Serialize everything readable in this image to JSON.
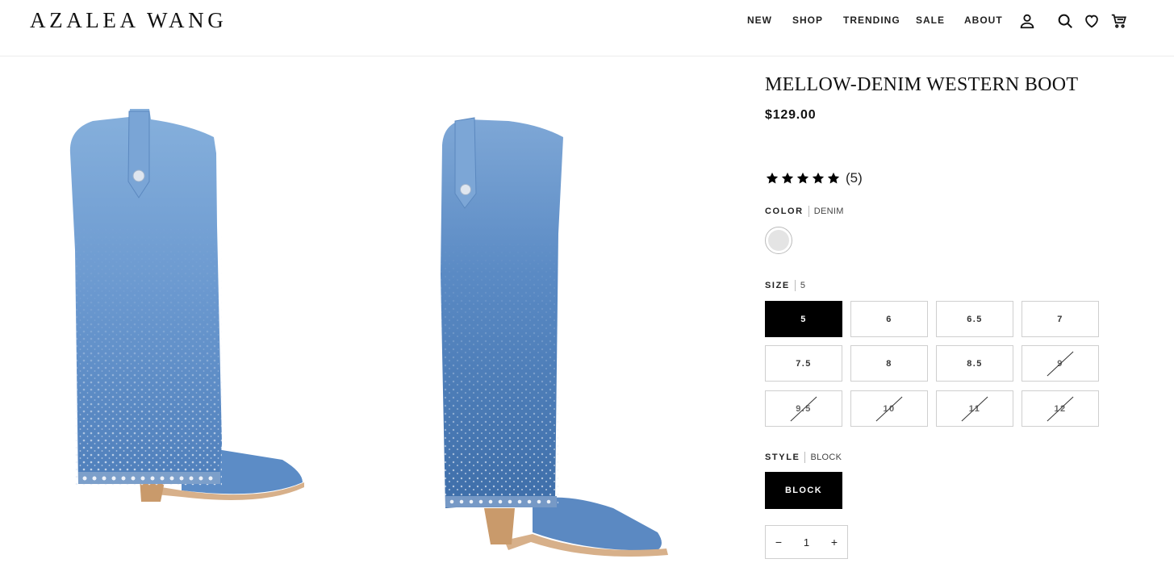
{
  "header": {
    "logo": "AZALEA WANG",
    "nav": [
      "NEW",
      "SHOP",
      "TRENDING",
      "SALE",
      "ABOUT"
    ],
    "icons": [
      "account-icon",
      "search-icon",
      "wishlist-heart-icon",
      "cart-icon"
    ]
  },
  "gallery": {
    "images": [
      "boot-side-view",
      "boot-angle-view"
    ]
  },
  "product": {
    "title": "MELLOW-DENIM WESTERN BOOT",
    "price": "$129.00",
    "rating": {
      "stars": 5,
      "count": "(5)"
    },
    "color": {
      "label": "COLOR",
      "value": "DENIM",
      "swatch_color": "#e4e4e4"
    },
    "size": {
      "label": "SIZE",
      "value": "5",
      "options": [
        {
          "label": "5",
          "selected": true,
          "available": true
        },
        {
          "label": "6",
          "selected": false,
          "available": true
        },
        {
          "label": "6.5",
          "selected": false,
          "available": true
        },
        {
          "label": "7",
          "selected": false,
          "available": true
        },
        {
          "label": "7.5",
          "selected": false,
          "available": true
        },
        {
          "label": "8",
          "selected": false,
          "available": true
        },
        {
          "label": "8.5",
          "selected": false,
          "available": true
        },
        {
          "label": "9",
          "selected": false,
          "available": false
        },
        {
          "label": "9.5",
          "selected": false,
          "available": false
        },
        {
          "label": "10",
          "selected": false,
          "available": false
        },
        {
          "label": "11",
          "selected": false,
          "available": false
        },
        {
          "label": "12",
          "selected": false,
          "available": false
        }
      ]
    },
    "style": {
      "label": "STYLE",
      "value": "BLOCK",
      "option": "BLOCK"
    },
    "quantity": {
      "minus": "−",
      "value": "1",
      "plus": "+"
    }
  },
  "colors": {
    "denim_light": "#8db3dc",
    "denim_mid": "#5f8fc8",
    "denim_dark": "#3f6fa8",
    "heel": "#c99a6b",
    "sole": "#d9b48c"
  }
}
